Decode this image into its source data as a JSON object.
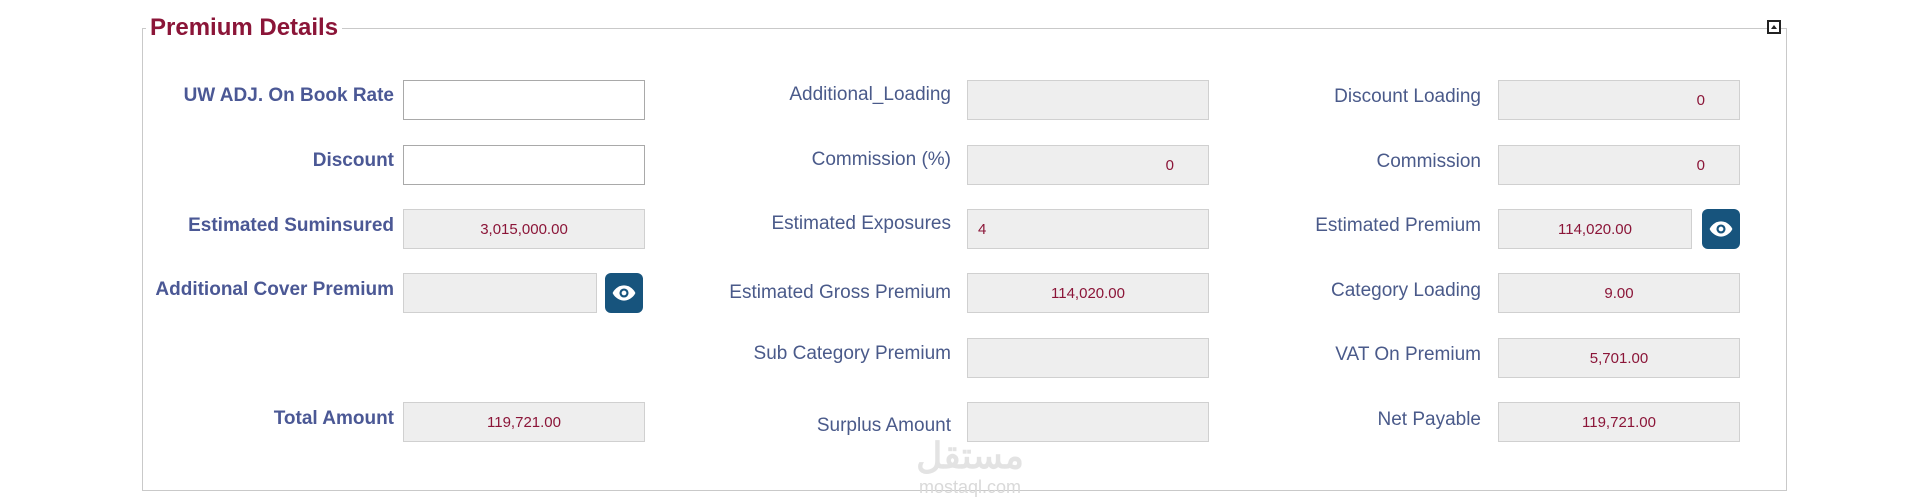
{
  "panel": {
    "title": "Premium Details",
    "collapse_icon": "collapse-up-icon"
  },
  "col1": {
    "uw_adj_label": "UW ADJ. On Book Rate",
    "uw_adj_value": "",
    "discount_label": "Discount",
    "discount_value": "",
    "est_suminsured_label": "Estimated Suminsured",
    "est_suminsured_value": "3,015,000.00",
    "add_cover_label": "Additional Cover Premium",
    "add_cover_value": "",
    "total_amount_label": "Total Amount",
    "total_amount_value": "119,721.00"
  },
  "col2": {
    "add_loading_label": "Additional_Loading",
    "add_loading_value": "",
    "commission_pct_label": "Commission (%)",
    "commission_pct_value": "0",
    "est_exposures_label": "Estimated Exposures",
    "est_exposures_value": "4",
    "est_gross_label": "Estimated Gross Premium",
    "est_gross_value": "114,020.00",
    "sub_cat_label": "Sub Category Premium",
    "sub_cat_value": "",
    "surplus_label": "Surplus Amount",
    "surplus_value": ""
  },
  "col3": {
    "discount_loading_label": "Discount Loading",
    "discount_loading_value": "0",
    "commission_label": "Commission",
    "commission_value": "0",
    "est_premium_label": "Estimated Premium",
    "est_premium_value": "114,020.00",
    "category_loading_label": "Category Loading",
    "category_loading_value": "9.00",
    "vat_label": "VAT On Premium",
    "vat_value": "5,701.00",
    "net_payable_label": "Net Payable",
    "net_payable_value": "119,721.00"
  },
  "icons": {
    "view_icon": "eye-icon"
  },
  "watermark": {
    "arabic": "مستقل",
    "latin": "mostaql.com"
  },
  "colors": {
    "title": "#8b1538",
    "label": "#4a5a8a",
    "value": "#8b1538",
    "button": "#17547d"
  }
}
